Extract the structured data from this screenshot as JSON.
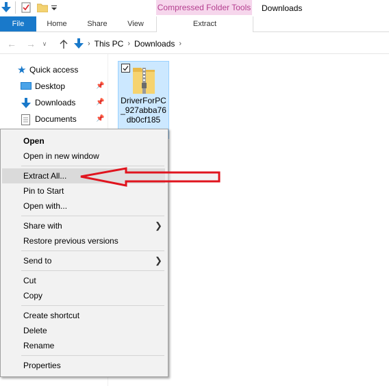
{
  "ribbon": {
    "context_group": "Compressed Folder Tools",
    "window_title": "Downloads",
    "tabs": {
      "file": "File",
      "home": "Home",
      "share": "Share",
      "view": "View",
      "extract": "Extract"
    },
    "accent": "#1979ca"
  },
  "address": {
    "path": [
      "This PC",
      "Downloads"
    ]
  },
  "nav_pane": {
    "quick_access": "Quick access",
    "items": [
      "Desktop",
      "Downloads",
      "Documents"
    ]
  },
  "file": {
    "name": "DriverForPC_927abba76db0cf185"
  },
  "context_menu": {
    "open": "Open",
    "open_new_window": "Open in new window",
    "extract_all": "Extract All...",
    "pin_to_start": "Pin to Start",
    "open_with": "Open with...",
    "share_with": "Share with",
    "restore_previous": "Restore previous versions",
    "send_to": "Send to",
    "cut": "Cut",
    "copy": "Copy",
    "create_shortcut": "Create shortcut",
    "delete": "Delete",
    "rename": "Rename",
    "properties": "Properties"
  },
  "icons": {
    "qat_down": "download-arrow-icon",
    "qat_properties": "properties-check-icon",
    "qat_folder": "new-folder-icon",
    "nav_up": "up-arrow-icon",
    "pin": "pin-icon",
    "zip": "zip-folder-icon",
    "callout": "red-arrow-icon"
  },
  "colors": {
    "callout_red": "#e0141e",
    "selection": "#cce8ff"
  }
}
